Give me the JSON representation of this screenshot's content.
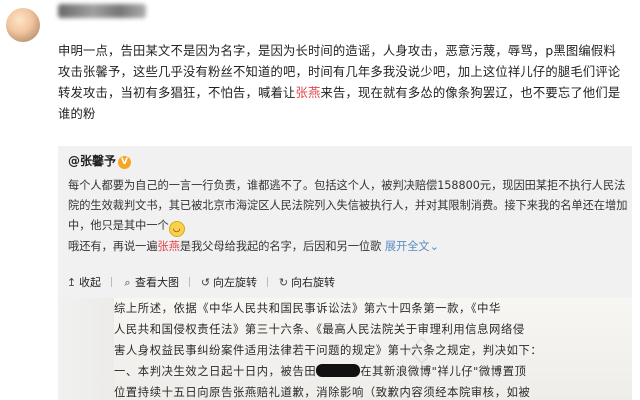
{
  "post": {
    "text_parts": [
      "申明一点，告田某文不是因为名字，是因为长时间的造谣，人身攻击，恶意污蔑，辱骂，p黑图编假料攻击张馨予，这些几乎没有粉丝不知道的吧，时间有几年多我没说少吧，加上这位祥儿仔的腿毛们评论转发攻击，当初有多猖狂，不怕告，喊着让",
      "张燕",
      "来告，现在就有多怂的像条狗罢辽，也不要忘了他们是谁的粉"
    ]
  },
  "quote": {
    "author": "@张馨予",
    "verified": "V",
    "body_1": "每个人都要为自己的一言一行负责，谁都逃不了。包括这个人，被判决赔偿158800元，现因田某拒不执行人民法院的生效裁判文书，其已被北京市海淀区人民法院列入失信被执行人，并对其限制消费。接下来我的名单还在增加中，他只是其中一个",
    "emoji": "smile-emoji",
    "body_2a": "哦还有，再说一遍",
    "body_2_red": "张燕",
    "body_2b": "是我父母给我起的名字，后因和另一位歌",
    "expand": "展开全文",
    "expand_icon": "chevron-down"
  },
  "toolbar": {
    "collapse": "收起",
    "view_original": "查看大图",
    "rotate_left": "向左旋转",
    "rotate_right": "向右旋转"
  },
  "document": {
    "line_1": "综上所述，依据《中华人民共和国民事诉讼法》第六十四条第一款，《中华",
    "line_2": "人民共和国侵权责任法》第三十六条、《最高人民法院关于审理利用信息网络侵",
    "line_3": "害人身权益民事纠纷案件适用法律若干问题的规定》第十六条之规定，判决如下：",
    "line_4a": "一、本判决生效之日起十日内，被告田",
    "line_4b": "在其新浪微博\"祥儿仔\"微博置顶",
    "line_5": "位置持续十五日向原告张燕赔礼道歉，消除影响（致歉内容须经本院审核，如被"
  }
}
